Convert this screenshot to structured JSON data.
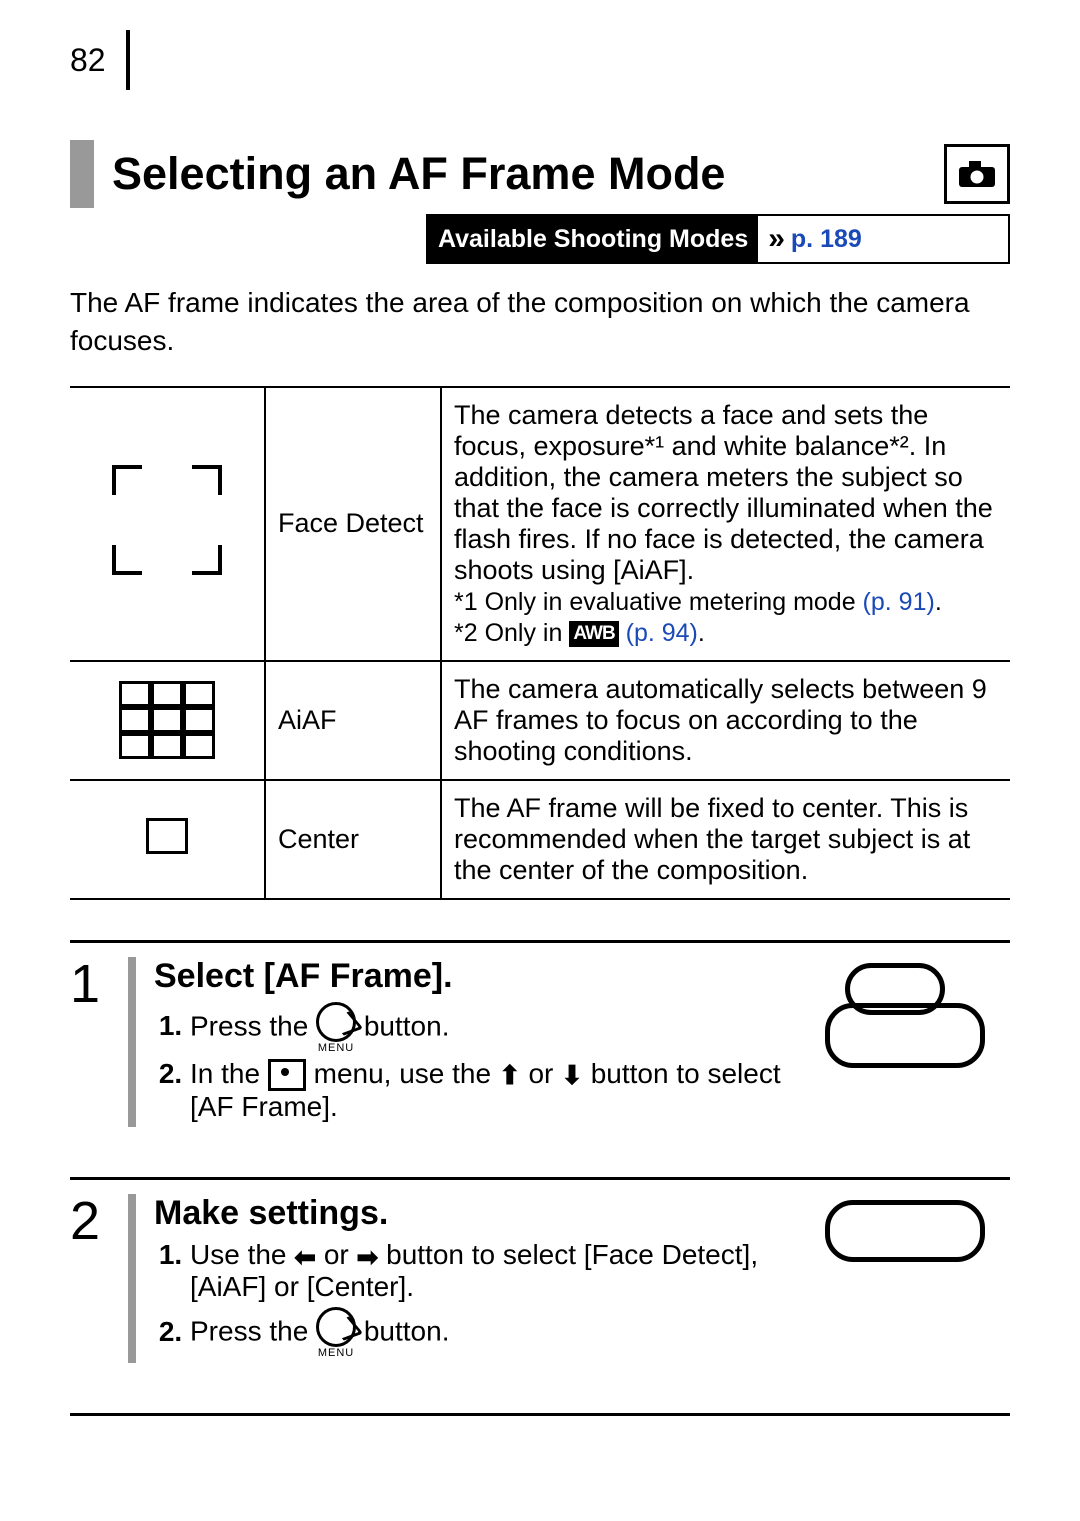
{
  "page_number": "82",
  "title": "Selecting an AF Frame Mode",
  "modes_bar": {
    "label": "Available Shooting Modes",
    "link": "p. 189"
  },
  "intro": "The AF frame indicates the area of the composition on which the camera focuses.",
  "table": {
    "rows": [
      {
        "name": "Face Detect",
        "desc_main": "The camera detects a face and sets the focus, exposure*¹ and white balance*². In addition, the camera meters the subject so that the face is correctly illuminated when the flash fires. If no face is detected, the camera shoots using [AiAF].",
        "note1_pre": "*1 Only in evaluative metering mode ",
        "note1_link": "(p. 91)",
        "note1_post": ".",
        "note2_pre": "*2 Only in ",
        "note2_badge": "AWB",
        "note2_link": " (p. 94)",
        "note2_post": "."
      },
      {
        "name": "AiAF",
        "desc_main": "The camera automatically selects between 9 AF frames to focus on according to the shooting conditions."
      },
      {
        "name": "Center",
        "desc_main": "The AF frame will be fixed to center. This is recommended when the target subject is at the center of the composition."
      }
    ]
  },
  "steps": [
    {
      "num": "1",
      "title": "Select [AF Frame].",
      "i1_pre": "Press the ",
      "i1_post": " button.",
      "menu_label": "MENU",
      "i2_a": "In the ",
      "i2_b": " menu, use the ",
      "i2_c": " or ",
      "i2_d": " button to select [AF Frame]."
    },
    {
      "num": "2",
      "title": "Make settings.",
      "i1_a": "Use the ",
      "i1_b": " or ",
      "i1_c": " button to select [Face Detect], [AiAF] or [Center].",
      "i2_pre": "Press the ",
      "i2_post": " button.",
      "menu_label": "MENU"
    }
  ]
}
